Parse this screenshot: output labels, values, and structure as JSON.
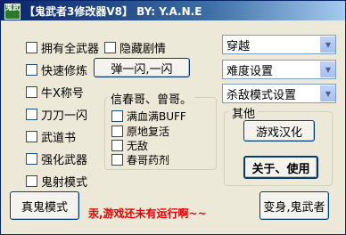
{
  "window": {
    "title": "【鬼武者3修改器V8】 BY: Y.A.N.E",
    "icon_text": "鬼武"
  },
  "checkboxes_left": [
    {
      "label": "拥有全武器"
    },
    {
      "label": "快速修炼"
    },
    {
      "label": "牛X称号"
    },
    {
      "label": "刀刀一闪"
    },
    {
      "label": "武道书"
    },
    {
      "label": "强化武器"
    },
    {
      "label": "鬼射模式"
    }
  ],
  "hide_plot": {
    "label": "隐藏剧情"
  },
  "buttons": {
    "flash": "弹一闪,一闪",
    "game_localize": "游戏汉化",
    "about": "关于、使用",
    "true_demon": "真鬼模式",
    "transform": "变身,鬼武者"
  },
  "dropdowns": [
    {
      "value": "穿越"
    },
    {
      "value": "难度设置"
    },
    {
      "value": "杀敌模式设置"
    }
  ],
  "group_believe": {
    "title": "信春哥、曾哥。",
    "items": [
      {
        "label": "满血满BUFF"
      },
      {
        "label": "原地复活"
      },
      {
        "label": "无敌"
      },
      {
        "label": "春哥药剂"
      }
    ]
  },
  "group_other": {
    "title": "其他"
  },
  "status_text": "汞,游戏还未有运行啊~~"
}
